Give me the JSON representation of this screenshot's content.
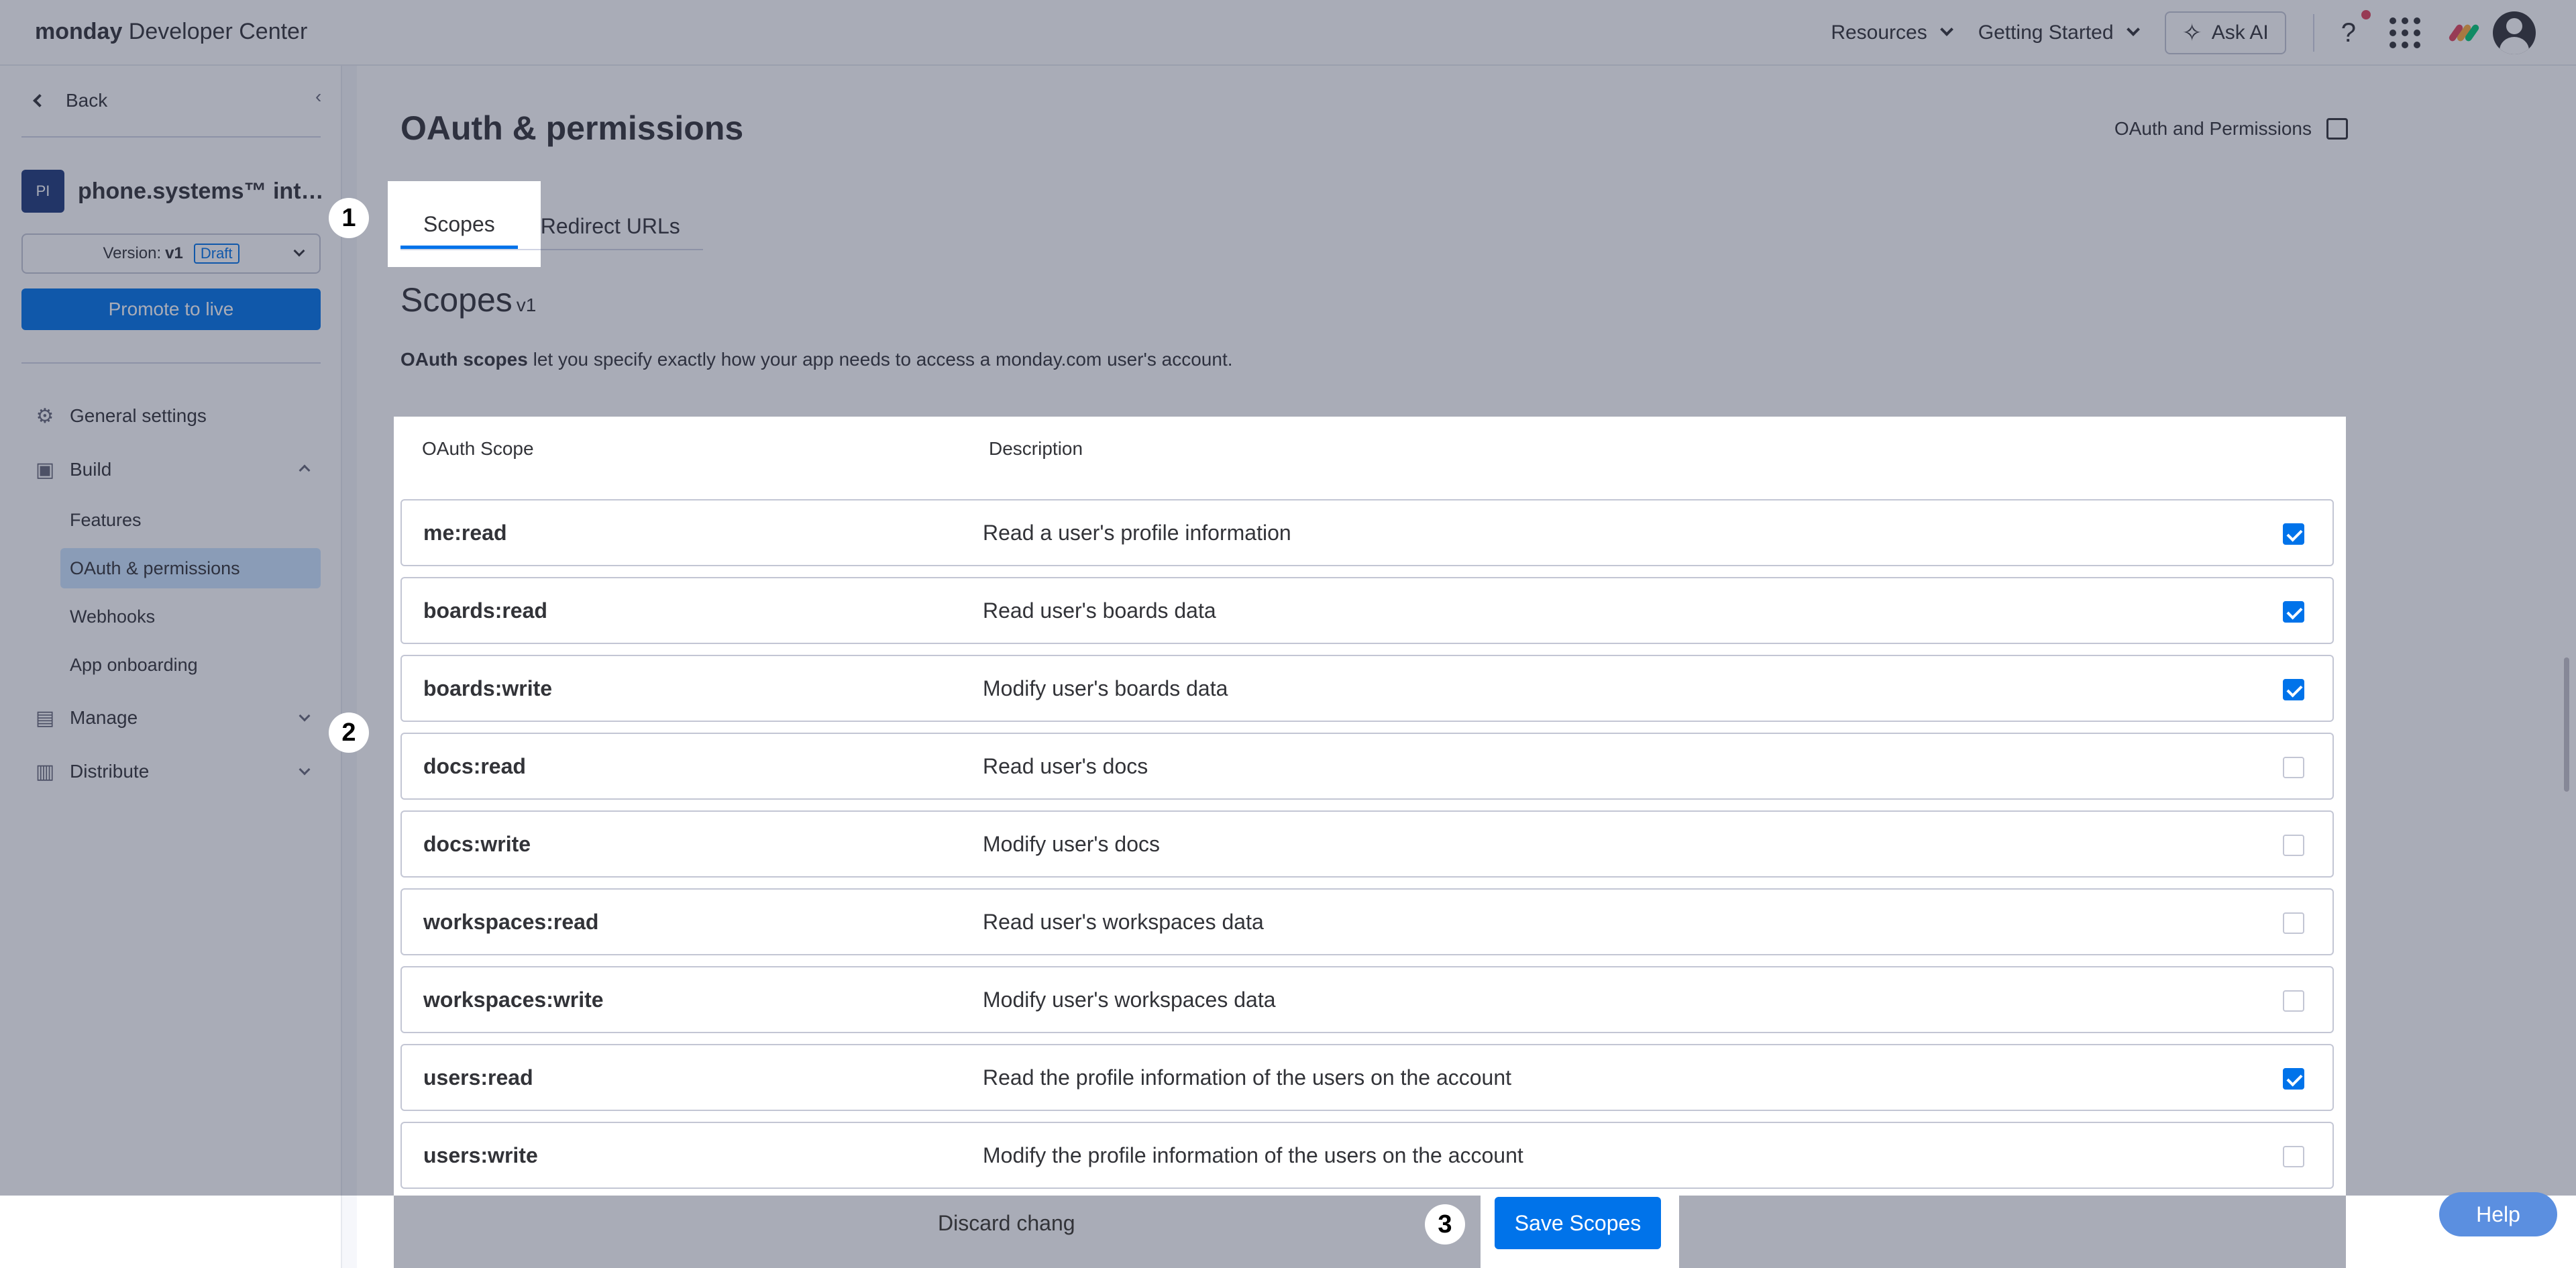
{
  "topbar": {
    "brand_bold": "monday",
    "brand_rest": " Developer Center",
    "resources": "Resources",
    "getting_started": "Getting Started",
    "ask_ai": "Ask AI",
    "help": "?"
  },
  "sidebar": {
    "back": "Back",
    "app_badge": "PI",
    "app_name": "phone.systems™ integ...",
    "version_label": "Version:",
    "version_value": "v1",
    "version_status": "Draft",
    "promote": "Promote to live",
    "general_settings": "General settings",
    "build": "Build",
    "build_items": [
      "Features",
      "OAuth & permissions",
      "Webhooks",
      "App onboarding"
    ],
    "manage": "Manage",
    "distribute": "Distribute"
  },
  "main": {
    "title": "OAuth & permissions",
    "docs_link": "OAuth and Permissions",
    "tabs": [
      "Scopes",
      "Redirect URLs"
    ],
    "section_title": "Scopes",
    "section_version": "v1",
    "desc_bold": "OAuth scopes",
    "desc_rest": " let you specify exactly how your app needs to access a monday.com user's account.",
    "columns": [
      "OAuth Scope",
      "Description"
    ],
    "rows": [
      {
        "scope": "me:read",
        "description": "Read a user's profile information",
        "checked": true
      },
      {
        "scope": "boards:read",
        "description": "Read user's boards data",
        "checked": true
      },
      {
        "scope": "boards:write",
        "description": "Modify user's boards data",
        "checked": true
      },
      {
        "scope": "docs:read",
        "description": "Read user's docs",
        "checked": false
      },
      {
        "scope": "docs:write",
        "description": "Modify user's docs",
        "checked": false
      },
      {
        "scope": "workspaces:read",
        "description": "Read user's workspaces data",
        "checked": false
      },
      {
        "scope": "workspaces:write",
        "description": "Modify user's workspaces data",
        "checked": false
      },
      {
        "scope": "users:read",
        "description": "Read the profile information of the users on the account",
        "checked": true
      },
      {
        "scope": "users:write",
        "description": "Modify the profile information of the users on the account",
        "checked": false
      }
    ],
    "discard": "Discard chang",
    "save": "Save Scopes"
  },
  "markers": [
    "1",
    "2",
    "3"
  ],
  "help_button": "Help",
  "colors": {
    "accent": "#0073ea",
    "overlay": "rgba(41,47,76,0.4)"
  }
}
